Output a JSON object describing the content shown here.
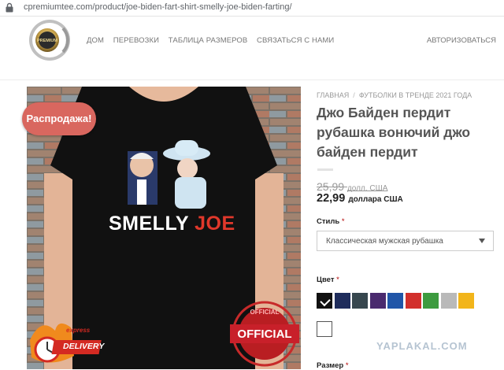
{
  "browser": {
    "url": "cpremiumtee.com/product/joe-biden-fart-shirt-smelly-joe-biden-farting/"
  },
  "header": {
    "logo_text": "PREMIUM",
    "nav": [
      "ДОМ",
      "ПЕРЕВОЗКИ",
      "ТАБЛИЦА РАЗМЕРОВ",
      "СВЯЗАТЬСЯ С НАМИ"
    ],
    "login": "АВТОРИЗОВАТЬСЯ"
  },
  "product": {
    "sale_badge": "Распродажа!",
    "shirt_text_1": "SMELLY",
    "shirt_text_2": "JOE",
    "badge_official": "OFFICIAL",
    "badge_official_small": "OFFICIAL",
    "badge_delivery": "DELIVERY",
    "badge_express": "express",
    "breadcrumb": [
      "ГЛАВНАЯ",
      "ФУТБОЛКИ В ТРЕНДЕ 2021 ГОДА"
    ],
    "title": "Джо Байден пердит рубашка вонючий джо байден пердит",
    "old_price": "25,99",
    "old_price_unit": "долл. США",
    "new_price": "22,99",
    "new_price_unit": "доллара США",
    "style_label": "Стиль",
    "style_value": "Классическая мужская рубашка",
    "color_label": "Цвет",
    "required_mark": "*",
    "colors": [
      "#111111",
      "#1f2d5c",
      "#37474f",
      "#4a2a6e",
      "#2156a8",
      "#d2302c",
      "#3d9b3f",
      "#b9b9b9",
      "#f2b51b"
    ],
    "size_label": "Размер"
  },
  "watermark": "YAPLAKAL.COM"
}
